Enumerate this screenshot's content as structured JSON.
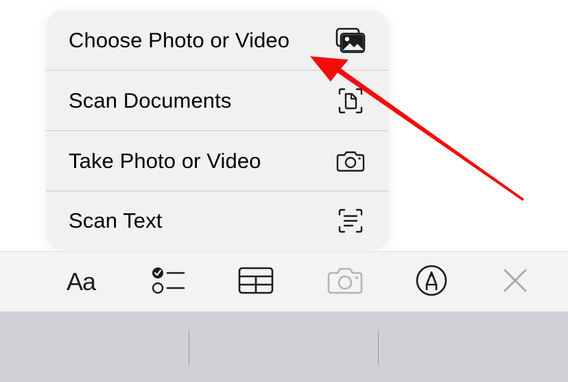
{
  "menu": {
    "items": [
      {
        "label": "Choose Photo or Video",
        "icon": "photo-library-icon"
      },
      {
        "label": "Scan Documents",
        "icon": "scan-document-icon"
      },
      {
        "label": "Take Photo or Video",
        "icon": "camera-icon"
      },
      {
        "label": "Scan Text",
        "icon": "scan-text-icon"
      }
    ]
  },
  "toolbar": {
    "format_label": "Aa",
    "buttons": [
      "format-button",
      "checklist-button",
      "table-button",
      "camera-button",
      "markup-button",
      "close-button"
    ]
  },
  "colors": {
    "menu_background": "#f1f1f2",
    "toolbar_background": "#f3f3f4",
    "keyboard_background": "#cfd1d6",
    "disabled_icon": "#b3b3b8",
    "annotation_arrow": "#f20d0d"
  }
}
